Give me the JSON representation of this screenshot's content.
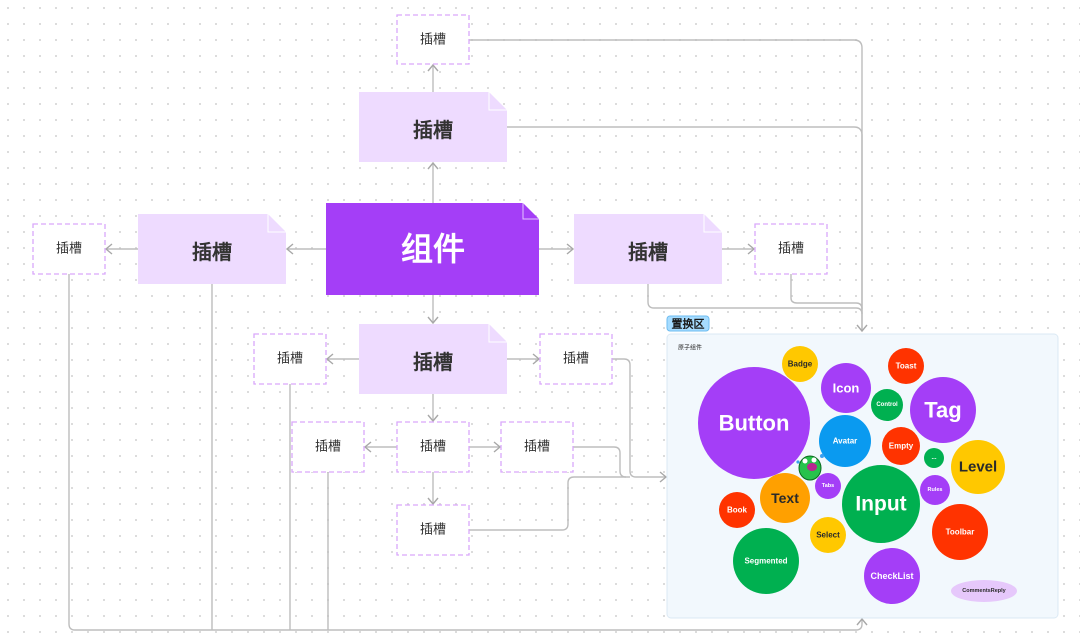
{
  "slot_label": "插槽",
  "component_label": "组件",
  "replace_zone": {
    "tag": "置换区",
    "subtitle": "原子组件"
  },
  "colors": {
    "purple": "#a43ef7",
    "slot_fill": "#eedbff",
    "blue": "#0a9af0",
    "green": "#00b050",
    "red": "#ff3300",
    "yellow": "#ffc800",
    "orange": "#ffa000",
    "lavender": "#e6c8fb"
  },
  "atoms": [
    {
      "label": "Button",
      "color": "purple"
    },
    {
      "label": "Badge",
      "color": "yellow"
    },
    {
      "label": "Icon",
      "color": "purple"
    },
    {
      "label": "Toast",
      "color": "red"
    },
    {
      "label": "Control",
      "color": "green"
    },
    {
      "label": "Tag",
      "color": "purple"
    },
    {
      "label": "Avatar",
      "color": "blue"
    },
    {
      "label": "Empty",
      "color": "red"
    },
    {
      "label": "...",
      "color": "green"
    },
    {
      "label": "Level",
      "color": "yellow"
    },
    {
      "label": "Text",
      "color": "orange"
    },
    {
      "label": "Book",
      "color": "red"
    },
    {
      "label": "Tabs",
      "color": "purple"
    },
    {
      "label": "Input",
      "color": "green"
    },
    {
      "label": "Rules",
      "color": "purple"
    },
    {
      "label": "Toolbar",
      "color": "red"
    },
    {
      "label": "Select",
      "color": "yellow"
    },
    {
      "label": "Segmented",
      "color": "green"
    },
    {
      "label": "CheckList",
      "color": "purple"
    },
    {
      "label": "CommentsReply",
      "color": "lavender"
    }
  ]
}
